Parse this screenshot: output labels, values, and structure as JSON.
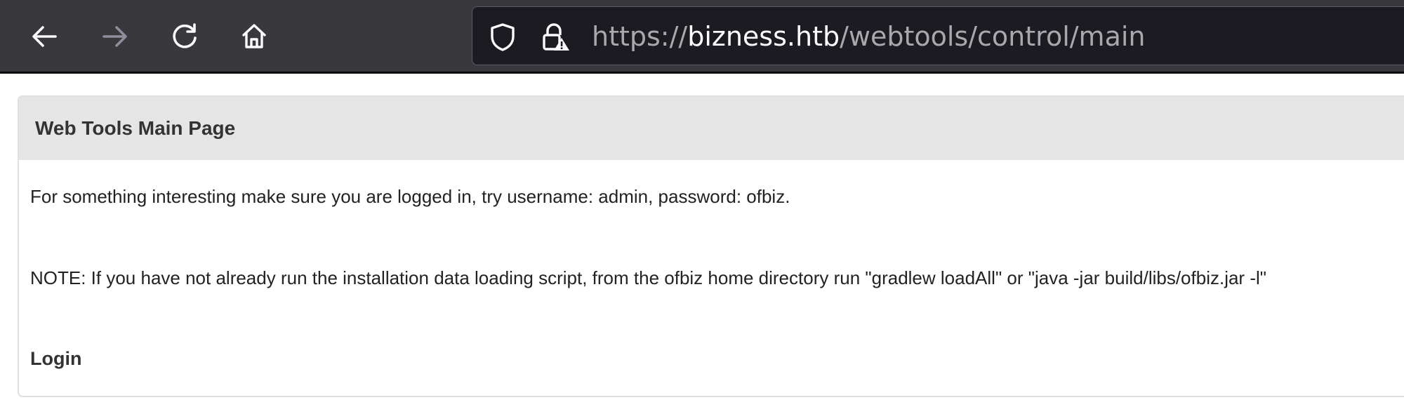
{
  "browser": {
    "icons": {
      "back": "arrow-left-icon",
      "forward": "arrow-right-icon",
      "reload": "reload-icon",
      "home": "home-icon",
      "shield": "shield-icon",
      "lock": "lock-warning-icon"
    },
    "url": {
      "scheme": "https://",
      "host": "bizness.htb",
      "path": "/webtools/control/main"
    },
    "colors": {
      "toolbar_bg": "#38383d",
      "urlbar_bg": "#1c1b22",
      "url_host": "#fbfbfe",
      "url_dim": "#a8a8ad"
    }
  },
  "page": {
    "title": "Web Tools Main Page",
    "info_text": "For something interesting make sure you are logged in, try username: admin, password: ofbiz.",
    "note_text": "NOTE: If you have not already run the installation data loading script, from the ofbiz home directory run \"gradlew loadAll\" or \"java -jar build/libs/ofbiz.jar -l\"",
    "login_label": "Login",
    "colors": {
      "title_bg": "#e5e5e5",
      "border": "#e0e0e0"
    }
  }
}
